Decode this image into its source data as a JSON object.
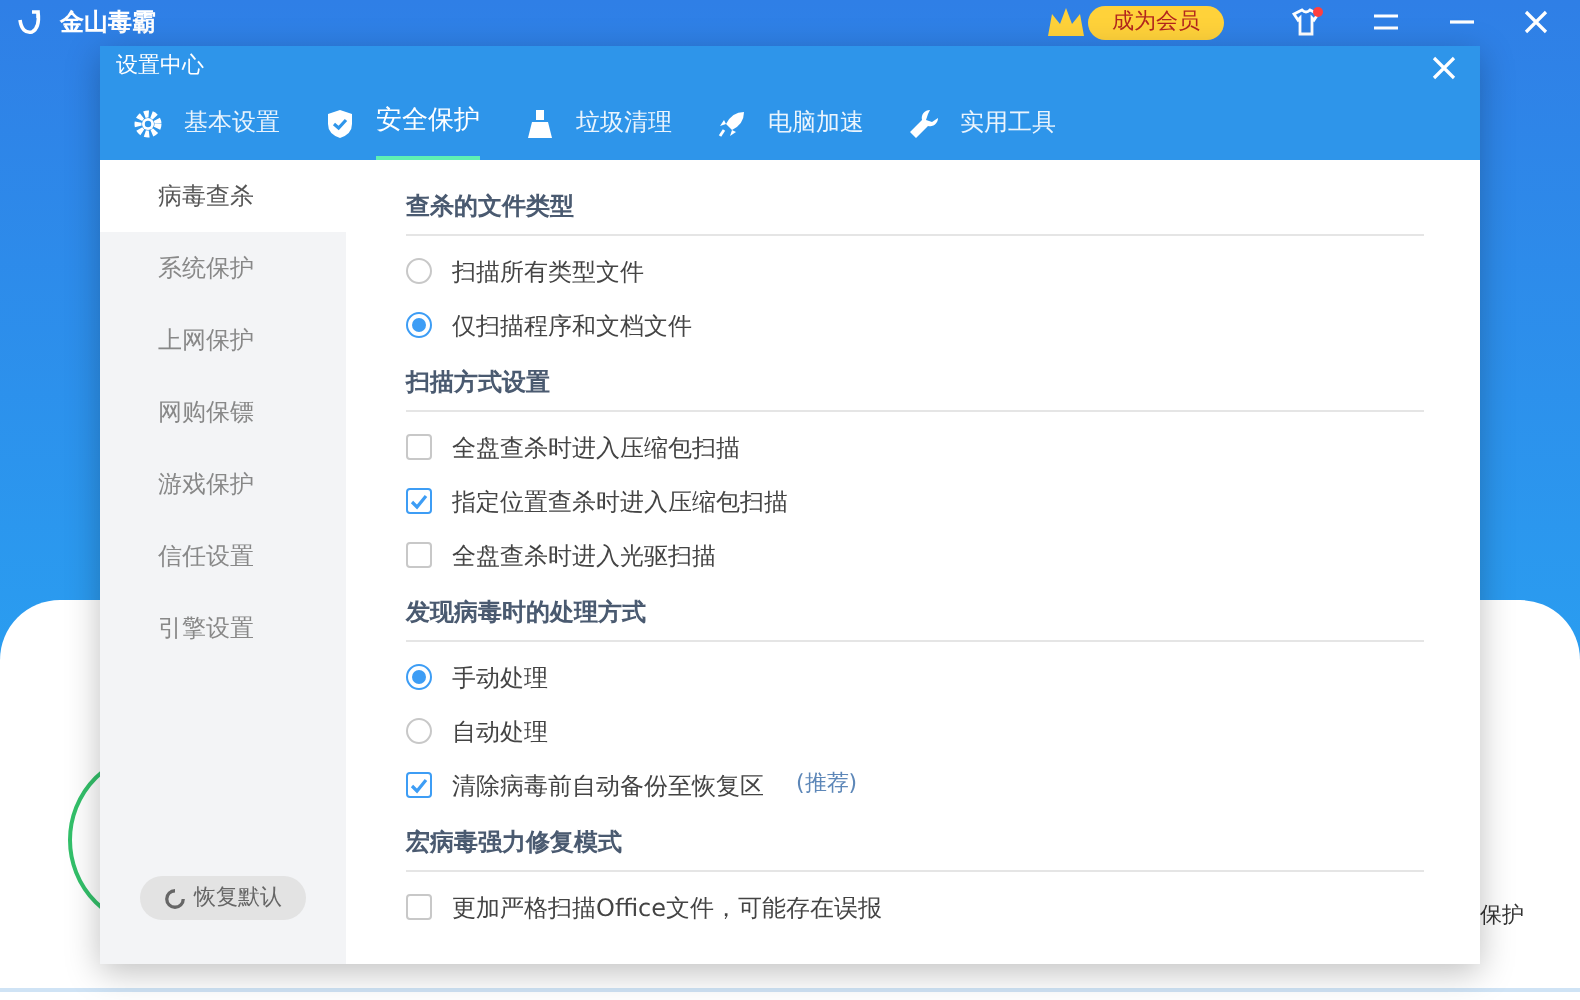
{
  "app": {
    "title": "金山毒霸",
    "vip_button": "成为会员",
    "partial_text": "保护"
  },
  "dialog": {
    "title": "设置中心",
    "tabs": [
      {
        "label": "基本设置",
        "selected": false
      },
      {
        "label": "安全保护",
        "selected": true
      },
      {
        "label": "垃圾清理",
        "selected": false
      },
      {
        "label": "电脑加速",
        "selected": false
      },
      {
        "label": "实用工具",
        "selected": false
      }
    ],
    "sidebar": {
      "items": [
        {
          "label": "病毒查杀",
          "selected": true
        },
        {
          "label": "系统保护",
          "selected": false
        },
        {
          "label": "上网保护",
          "selected": false
        },
        {
          "label": "网购保镖",
          "selected": false
        },
        {
          "label": "游戏保护",
          "selected": false
        },
        {
          "label": "信任设置",
          "selected": false
        },
        {
          "label": "引擎设置",
          "selected": false
        }
      ],
      "restore_button": "恢复默认"
    },
    "sections": [
      {
        "title": "查杀的文件类型",
        "options": [
          {
            "kind": "radio",
            "label": "扫描所有类型文件",
            "checked": false
          },
          {
            "kind": "radio",
            "label": "仅扫描程序和文档文件",
            "checked": true
          }
        ]
      },
      {
        "title": "扫描方式设置",
        "options": [
          {
            "kind": "checkbox",
            "label": "全盘查杀时进入压缩包扫描",
            "checked": false
          },
          {
            "kind": "checkbox",
            "label": "指定位置查杀时进入压缩包扫描",
            "checked": true
          },
          {
            "kind": "checkbox",
            "label": "全盘查杀时进入光驱扫描",
            "checked": false
          }
        ]
      },
      {
        "title": "发现病毒时的处理方式",
        "options": [
          {
            "kind": "radio",
            "label": "手动处理",
            "checked": true
          },
          {
            "kind": "radio",
            "label": "自动处理",
            "checked": false
          },
          {
            "kind": "checkbox",
            "label": "清除病毒前自动备份至恢复区",
            "note": "(推荐)",
            "checked": true
          }
        ]
      },
      {
        "title": "宏病毒强力修复模式",
        "options": [
          {
            "kind": "checkbox",
            "label": "更加严格扫描Office文件，可能存在误报",
            "checked": false
          }
        ]
      }
    ]
  }
}
